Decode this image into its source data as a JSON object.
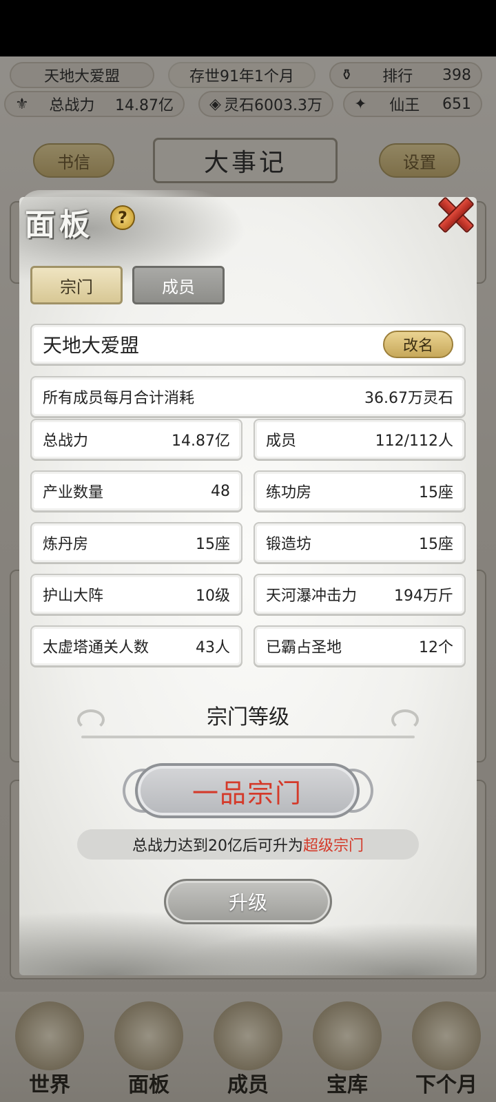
{
  "header": {
    "sect_name": "天地大爱盟",
    "era": "存世91年1个月",
    "rank_label": "排行",
    "rank_value": "398",
    "power_label": "总战力",
    "power_value": "14.87亿",
    "spirit_stone": "灵石6003.3万",
    "title_label": "仙王",
    "title_value": "651"
  },
  "bg_buttons": {
    "letters": "书信",
    "chronicle": "大事记",
    "settings": "设置"
  },
  "bottom_nav": [
    {
      "label": "世界"
    },
    {
      "label": "面板"
    },
    {
      "label": "成员"
    },
    {
      "label": "宝库"
    },
    {
      "label": "下个月"
    }
  ],
  "panel": {
    "title": "面板",
    "help_icon": "question-icon",
    "close_icon": "close-icon",
    "tabs": [
      {
        "label": "宗门",
        "active": true
      },
      {
        "label": "成员",
        "active": false
      }
    ],
    "sect_name": "天地大爱盟",
    "rename_label": "改名",
    "monthly_cost_label": "所有成员每月合计消耗",
    "monthly_cost_value": "36.67万灵石",
    "stats": [
      {
        "label": "总战力",
        "value": "14.87亿"
      },
      {
        "label": "成员",
        "value": "112/112人"
      },
      {
        "label": "产业数量",
        "value": "48"
      },
      {
        "label": "练功房",
        "value": "15座"
      },
      {
        "label": "炼丹房",
        "value": "15座"
      },
      {
        "label": "锻造坊",
        "value": "15座"
      },
      {
        "label": "护山大阵",
        "value": "10级"
      },
      {
        "label": "天河瀑冲击力",
        "value": "194万斤"
      },
      {
        "label": "太虚塔通关人数",
        "value": "43人"
      },
      {
        "label": "已霸占圣地",
        "value": "12个"
      }
    ],
    "rank_section_title": "宗门等级",
    "rank_current": "一品宗门",
    "upgrade_hint_prefix": "总战力达到20亿后可升为",
    "upgrade_hint_target": "超级宗门",
    "upgrade_button": "升级"
  },
  "colors": {
    "accent_red": "#d43a2a",
    "gold_button": "#d8c895"
  }
}
